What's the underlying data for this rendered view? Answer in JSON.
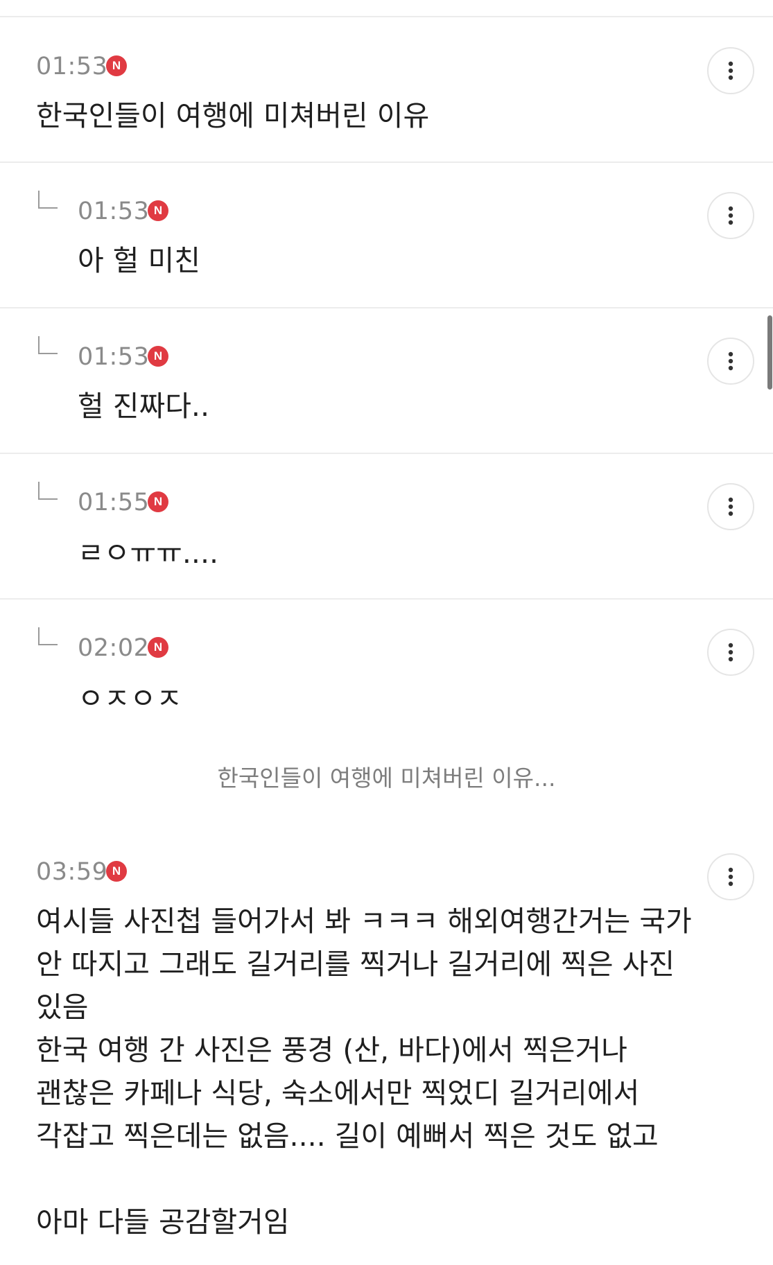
{
  "comments": [
    {
      "time": "01:53",
      "badge": "N",
      "text": "한국인들이 여행에 미쳐버린 이유"
    },
    {
      "time": "01:53",
      "badge": "N",
      "text": "아 헐 미친"
    },
    {
      "time": "01:53",
      "badge": "N",
      "text": "헐 진짜다.."
    },
    {
      "time": "01:55",
      "badge": "N",
      "text": "ㄹㅇㅠㅠ...."
    },
    {
      "time": "02:02",
      "badge": "N",
      "text": "ㅇㅈㅇㅈ"
    }
  ],
  "post_preview": "한국인들이 여행에 미쳐버린 이유...",
  "last_comment": {
    "time": "03:59",
    "badge": "N",
    "text": "여시들 사진첩 들어가서 봐 ㅋㅋㅋ 해외여행간거는 국가\n안 따지고 그래도 길거리를 찍거나 길거리에 찍은 사진\n있음\n한국 여행 간 사진은 풍경 (산, 바다)에서 찍은거나\n괜찮은 카페나 식당, 숙소에서만 찍었디 길거리에서\n각잡고 찍은데는 없음.... 길이 예뻐서 찍은 것도 없고\n\n아마 다들 공감할거임"
  },
  "icons": {
    "more": "more-vertical-icon",
    "reply": "reply-arrow-icon",
    "new": "new-badge-icon"
  },
  "colors": {
    "badge": "#e03a42",
    "time": "#8a8a8a",
    "divider": "#ececec"
  }
}
